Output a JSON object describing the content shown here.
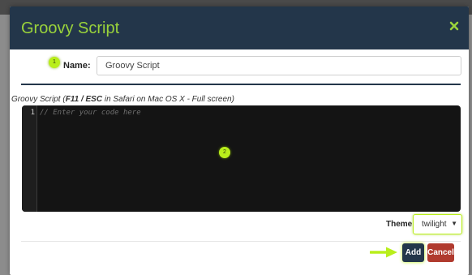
{
  "dialog": {
    "title": "Groovy Script",
    "close_icon": "close-icon"
  },
  "callouts": {
    "first": "1",
    "second": "2"
  },
  "form": {
    "name_label": "Name:",
    "name_value": "Groovy Script"
  },
  "editor": {
    "caption_prefix": "Groovy Script (",
    "caption_keys": "F11 / ESC",
    "caption_suffix": " in Safari on Mac OS X - Full screen)",
    "line_number": "1",
    "placeholder": "// Enter your code here"
  },
  "theme": {
    "label": "Theme:",
    "selected": "twilight"
  },
  "buttons": {
    "add": "Add",
    "cancel": "Cancel"
  },
  "colors": {
    "header_bg": "#23364a",
    "title": "#9ad33b",
    "callout": "#b9ee1b",
    "add_button": "#23364a",
    "cancel_button": "#b03a2e",
    "editor_bg": "#141414"
  }
}
